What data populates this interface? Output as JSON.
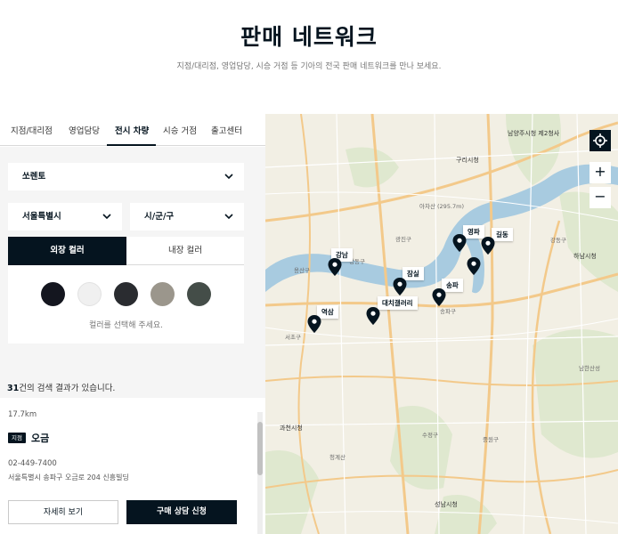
{
  "header": {
    "title": "판매 네트워크",
    "subtitle": "지점/대리점, 영업담당, 시승 거점 등 기아의 전국 판매 네트워크를 만나 보세요."
  },
  "tabs": [
    {
      "label": "지점/대리점"
    },
    {
      "label": "영업담당"
    },
    {
      "label": "전시 차량"
    },
    {
      "label": "시승 거점"
    },
    {
      "label": "출고센터"
    }
  ],
  "filters": {
    "model": "쏘렌토",
    "city": "서울특별시",
    "district": "시/군/구"
  },
  "colors": {
    "exterior_tab": "외장 컬러",
    "interior_tab": "내장 컬러",
    "swatches": [
      "#14161f",
      "#f0f0f0",
      "#2a2c30",
      "#9b968c",
      "#444d48"
    ],
    "hint": "컬러를 선택해 주세요."
  },
  "results": {
    "count": "31",
    "suffix": "건의 검색 결과가 있습니다."
  },
  "dealer": {
    "distance": "17.7km",
    "badge": "지점",
    "name": "오금",
    "phone": "02-449-7400",
    "address": "서울특별시 송파구 오금로 204 신흥빌딩",
    "detail_button": "자세히 보기",
    "consult_button": "구매 상담 신청"
  },
  "map": {
    "pins": [
      {
        "label": "강남"
      },
      {
        "label": "역삼"
      },
      {
        "label": "잠실"
      },
      {
        "label": "대치갤러리"
      },
      {
        "label": "송파"
      },
      {
        "label": "영파"
      },
      {
        "label": "길동"
      }
    ],
    "places": [
      {
        "label": "남양주시청 제2청사"
      },
      {
        "label": "구리시청"
      },
      {
        "label": "하남시청"
      },
      {
        "label": "과천시청"
      },
      {
        "label": "성남시청"
      },
      {
        "label": "강동구"
      },
      {
        "label": "송파구"
      },
      {
        "label": "서초구"
      },
      {
        "label": "수정구"
      },
      {
        "label": "중원구"
      },
      {
        "label": "광진구"
      },
      {
        "label": "성동구"
      },
      {
        "label": "용산구"
      },
      {
        "label": "남한산성"
      },
      {
        "label": "청계산"
      },
      {
        "label": "아차산 (295.7m)"
      }
    ],
    "zoom_in": "+",
    "zoom_out": "−"
  }
}
